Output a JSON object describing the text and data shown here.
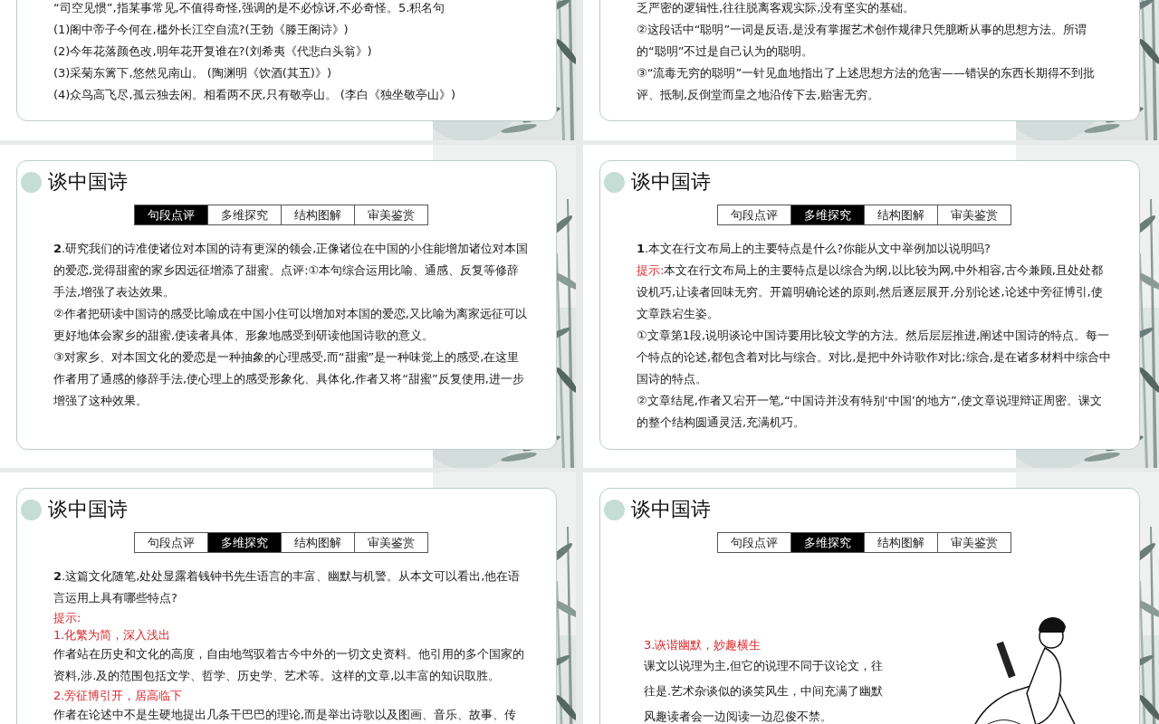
{
  "slides": [
    {
      "kind": "text",
      "body": [
        {
          "kind": "text",
          "text": "“司空见惯”,指某事常见,不值得奇怪,强调的是不必惊讶,不必奇怪。5.积名句"
        },
        {
          "kind": "text",
          "text": "(1)阁中帝子今何在,槛外长江空自流?(王勃《滕王阁诗》)"
        },
        {
          "kind": "text",
          "text": "(2)今年花落颜色改,明年花开复谁在?(刘希夷《代悲白头翁》)"
        },
        {
          "kind": "text",
          "text": "(3)采菊东篱下,悠然见南山。 (陶渊明《饮酒(其五)》)"
        },
        {
          "kind": "text",
          "text": "(4)众鸟高飞尽,孤云独去闲。相看两不厌,只有敬亭山。 (李白《独坐敬亭山》)"
        }
      ]
    },
    {
      "kind": "text",
      "body": [
        {
          "kind": "text",
          "text": "乏严密的逻辑性,往往脱离客观实际,没有坚实的基础。"
        },
        {
          "kind": "text",
          "text": "②这段话中“聪明”一词是反语,是没有掌握艺术创作规律只凭臆断从事的思想方法。所谓的“聪明”不过是自己认为的聪明。"
        },
        {
          "kind": "text",
          "text": "③“流毒无穷的聪明”一针见血地指出了上述思想方法的危害——错误的东西长期得不到批评、抵制,反倒堂而皇之地沿传下去,贻害无穷。"
        }
      ]
    },
    {
      "kind": "text",
      "title": "谈中国诗",
      "tabs": [
        {
          "label": "句段点评",
          "selected": true
        },
        {
          "label": "多维探究",
          "selected": false
        },
        {
          "label": "结构图解",
          "selected": false
        },
        {
          "label": "审美鉴赏",
          "selected": false
        }
      ],
      "body": [
        {
          "kind": "text",
          "text": "**2**.研究我们的诗准使诸位对本国的诗有更深的领会,正像诸位在中国的小住能增加诸位对本国的爱恋,觉得甜蜜的家乡因远征增添了甜蜜。点评:①本句综合运用比喻、通感、反复等修辞手法,增强了表达效果。"
        },
        {
          "kind": "text",
          "text": "②作者把研读中国诗的感受比喻成在中国小住可以增加对本国的爱恋,又比喻为离家远征可以更好地体会家乡的甜蜜,使读者具体、形象地感受到研读他国诗歌的意义。"
        },
        {
          "kind": "text",
          "text": "③对家乡、对本国文化的爱恋是一种抽象的心理感受,而“甜蜜”是一种味觉上的感受,在这里作者用了通感的修辞手法,使心理上的感受形象化、具体化,作者又将“甜蜜”反复使用,进一步增强了这种效果。"
        }
      ]
    },
    {
      "kind": "text",
      "title": "谈中国诗",
      "tabs": [
        {
          "label": "句段点评",
          "selected": false
        },
        {
          "label": "多维探究",
          "selected": true
        },
        {
          "label": "结构图解",
          "selected": false
        },
        {
          "label": "审美鉴赏",
          "selected": false
        }
      ],
      "body": [
        {
          "kind": "text",
          "text": "**1**.本文在行文布局上的主要特点是什么?你能从文中举例加以说明吗?"
        },
        {
          "kind": "hint",
          "label": "提示:",
          "text": "本文在行文布局上的主要特点是以综合为纲,以比较为网,中外相容,古今兼顾,且处处都设机巧,让读者回味无穷。开篇明确论述的原则,然后逐层展开,分别论述,论述中旁征博引,使文章跌宕生姿。"
        },
        {
          "kind": "text",
          "text": "①文章第1段,说明谈论中国诗要用比较文学的方法。然后层层推进,阐述中国诗的特点。每一个特点的论述,都包含着对比与综合。对比,是把中外诗歌作对比;综合,是在诸多材料中综合中国诗的特点。"
        },
        {
          "kind": "text",
          "text": "②文章结尾,作者又宕开一笔,“中国诗并没有特别‘中国’的地方”,使文章说理辩证周密。课文的整个结构圆通灵活,充满机巧。"
        }
      ]
    },
    {
      "kind": "text",
      "title": "谈中国诗",
      "tabs": [
        {
          "label": "句段点评",
          "selected": false
        },
        {
          "label": "多维探究",
          "selected": true
        },
        {
          "label": "结构图解",
          "selected": false
        },
        {
          "label": "审美鉴赏",
          "selected": false
        }
      ],
      "body": [
        {
          "kind": "text",
          "text": "**2**.这篇文化随笔,处处显露着钱钟书先生语言的丰富、幽默与机警。从本文可以看出,他在语言运用上具有哪些特点?"
        },
        {
          "kind": "heading",
          "text": "提示:"
        },
        {
          "kind": "heading",
          "text": "1.化繁为简，深入浅出"
        },
        {
          "kind": "text",
          "text": "作者站在历史和文化的高度，自由地驾驭着古今中外的一切文史资料。他引用的多个国家的资料,涉.及的范围包括文学、哲学、历史学、艺术等。这样的文章,以丰富的知识取胜。"
        },
        {
          "kind": "heading",
          "text": "2.旁征博引开，居高临下"
        },
        {
          "kind": "text",
          "text": "作者在论述中不是生硬地提出几条干巴巴的理论,而是举出诗歌以及图画、音乐、故事、传"
        }
      ]
    },
    {
      "kind": "illustrated",
      "title": "谈中国诗",
      "tabs": [
        {
          "label": "句段点评",
          "selected": false
        },
        {
          "label": "多维探究",
          "selected": true
        },
        {
          "label": "结构图解",
          "selected": false
        },
        {
          "label": "审美鉴赏",
          "selected": false
        }
      ],
      "body": [
        {
          "kind": "heading",
          "text": "3.诙谐幽默，妙趣横生"
        },
        {
          "kind": "text",
          "text": "课文以说理为主,但它的说理不同于议论文，往往是.艺术杂谈似的谈笑风生，中间充满了幽默风趣读者会一边阅读一边忍俊不禁。"
        }
      ]
    }
  ]
}
